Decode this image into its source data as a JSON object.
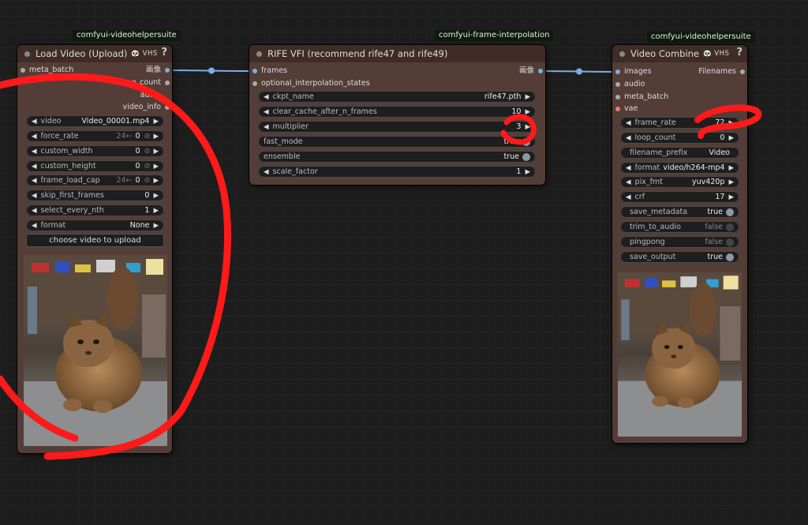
{
  "badges": {
    "load": "comfyui-videohelpersuite",
    "rife": "comfyui-frame-interpolation",
    "combine": "comfyui-videohelpersuite"
  },
  "vhs_tag": "🐼 VHS",
  "help_glyph": "?",
  "load_video": {
    "title": "Load Video (Upload)",
    "inputs": [
      "meta_batch"
    ],
    "outputs": [
      "画像",
      "frame_count",
      "audio",
      "video_info"
    ],
    "widgets": [
      {
        "label": "video",
        "value": "Video_00001.mp4"
      },
      {
        "label": "force_rate",
        "hint": "24←",
        "value": "0"
      },
      {
        "label": "custom_width",
        "value": "0"
      },
      {
        "label": "custom_height",
        "value": "0"
      },
      {
        "label": "frame_load_cap",
        "hint": "24←",
        "value": "0"
      },
      {
        "label": "skip_first_frames",
        "value": "0"
      },
      {
        "label": "select_every_nth",
        "value": "1"
      },
      {
        "label": "format",
        "value": "None"
      }
    ],
    "upload_label": "choose video to upload"
  },
  "rife": {
    "title": "RIFE VFI (recommend rife47 and rife49)",
    "inputs": [
      "frames",
      "optional_interpolation_states"
    ],
    "output": "画像",
    "widgets": [
      {
        "label": "ckpt_name",
        "value": "rife47.pth"
      },
      {
        "label": "clear_cache_after_n_frames",
        "value": "10"
      },
      {
        "label": "multiplier",
        "value": "3"
      },
      {
        "label": "fast_mode",
        "value": "true"
      },
      {
        "label": "ensemble",
        "value": "true"
      },
      {
        "label": "scale_factor",
        "value": "1"
      }
    ]
  },
  "video_combine": {
    "title": "Video Combine",
    "inputs": [
      "images",
      "audio",
      "meta_batch",
      "vae"
    ],
    "output": "Filenames",
    "widgets": [
      {
        "label": "frame_rate",
        "value": "72"
      },
      {
        "label": "loop_count",
        "value": "0"
      },
      {
        "label": "filename_prefix",
        "value": "Video"
      },
      {
        "label": "format",
        "value": "video/h264-mp4"
      },
      {
        "label": "pix_fmt",
        "value": "yuv420p"
      },
      {
        "label": "crf",
        "value": "17"
      },
      {
        "label": "save_metadata",
        "value": "true"
      },
      {
        "label": "trim_to_audio",
        "value": "false"
      },
      {
        "label": "pingpong",
        "value": "false"
      },
      {
        "label": "save_output",
        "value": "true"
      }
    ]
  },
  "colors": {
    "node_body": "#543d36",
    "node_header": "#3f2c27",
    "link": "#7aaee6",
    "annotation": "#ff1a1a"
  }
}
